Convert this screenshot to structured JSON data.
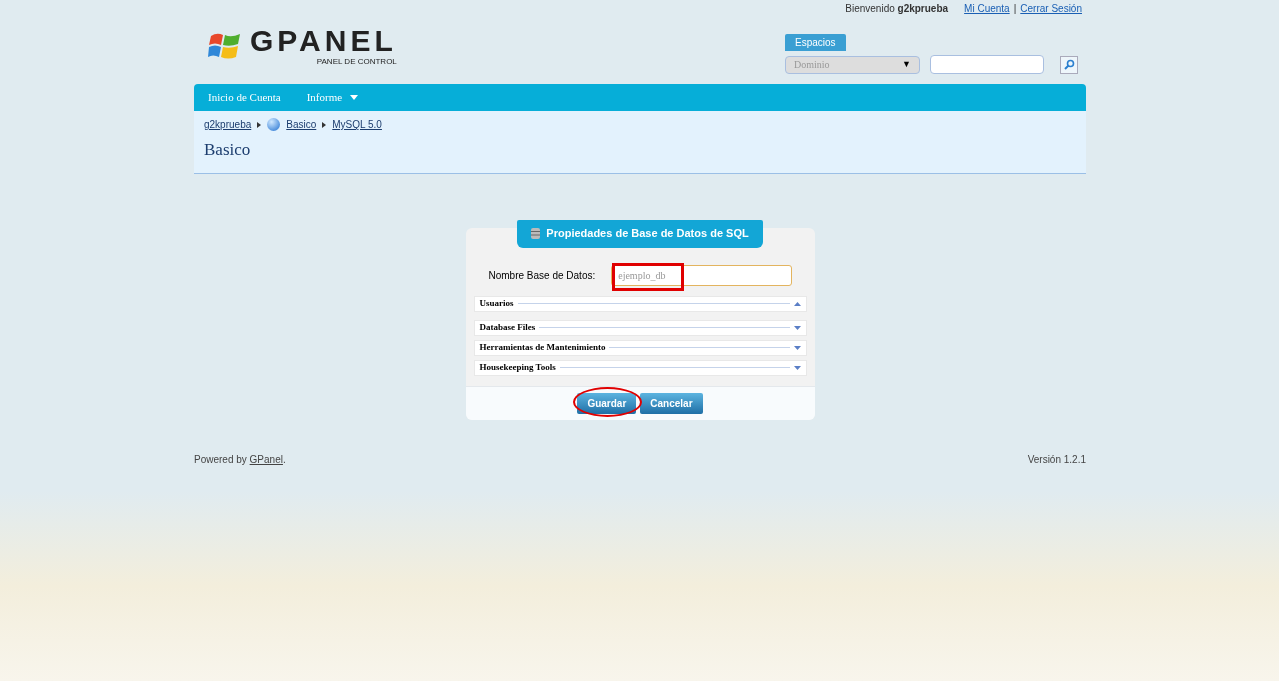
{
  "header": {
    "welcome": "Bienvenido",
    "user": "g2kprueba",
    "links": [
      "Mi Cuenta",
      "Cerrar Sesión"
    ],
    "separator": "|"
  },
  "logo": {
    "wordmark": "GPANEL",
    "tagline": "PANEL DE CONTROL"
  },
  "spaces": {
    "label": "Espacios",
    "select": "Dominio",
    "arrow": "▼"
  },
  "nav": [
    {
      "label": "Inicio de Cuenta",
      "dropdown": false
    },
    {
      "label": "Informe",
      "dropdown": true
    }
  ],
  "breadcrumb": [
    {
      "label": "g2kprueba",
      "icon": false
    },
    {
      "label": "Basico",
      "icon": true
    },
    {
      "label": "MySQL 5.0",
      "icon": false
    }
  ],
  "page_title": "Basico",
  "panel": {
    "title": "Propiedades de Base de Datos de SQL",
    "field_label": "Nombre Base de Datos:",
    "field_value": "ejemplo_db",
    "sections": [
      {
        "label": "Usuarios",
        "expanded": true
      },
      {
        "label": "Database Files",
        "expanded": false
      },
      {
        "label": "Herramientas de Mantenimiento",
        "expanded": false
      },
      {
        "label": "Housekeeping Tools",
        "expanded": false
      }
    ],
    "buttons": [
      "Guardar",
      "Cancelar"
    ]
  },
  "footer": {
    "powered": "Powered by",
    "link": "GPanel",
    "period": ".",
    "version": "Versión 1.2.1"
  }
}
